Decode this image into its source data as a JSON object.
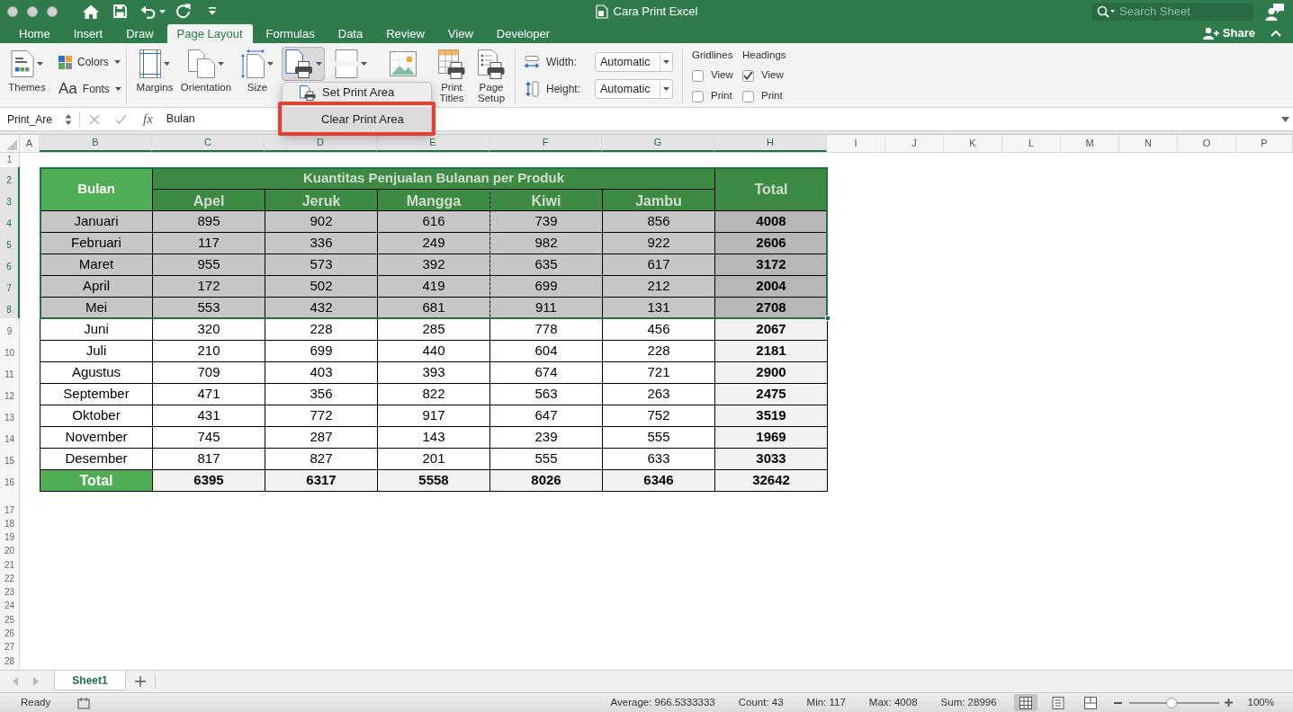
{
  "window": {
    "title": "Cara Print Excel"
  },
  "title_bar": {
    "search": {
      "placeholder": "Search Sheet"
    },
    "share": {
      "label": "Share"
    }
  },
  "tabs": [
    {
      "label": "Home",
      "selected": false
    },
    {
      "label": "Insert",
      "selected": false
    },
    {
      "label": "Draw",
      "selected": false
    },
    {
      "label": "Page Layout",
      "selected": true
    },
    {
      "label": "Formulas",
      "selected": false
    },
    {
      "label": "Data",
      "selected": false
    },
    {
      "label": "Review",
      "selected": false
    },
    {
      "label": "View",
      "selected": false
    },
    {
      "label": "Developer",
      "selected": false
    }
  ],
  "ribbon": {
    "themes": [
      {
        "kind": "themes",
        "label": "Themes",
        "dropdown": true,
        "pressed": false
      },
      {
        "kind": "colors",
        "label": "Colors",
        "dropdown": true,
        "pressed": false
      },
      {
        "kind": "fonts",
        "glyph": "Aa",
        "label": "Fonts",
        "dropdown": true,
        "pressed": false
      }
    ],
    "page_setup": [
      {
        "kind": "margins",
        "label": "Margins",
        "dropdown": true,
        "pressed": false
      },
      {
        "kind": "orientation",
        "label": "Orientation",
        "dropdown": true,
        "pressed": false
      },
      {
        "kind": "size",
        "label": "Size",
        "dropdown": true,
        "pressed": false
      },
      {
        "kind": "print_area",
        "dropdown": true,
        "pressed": true
      },
      {
        "kind": "breaks",
        "dropdown": true,
        "pressed": false
      },
      {
        "kind": "background",
        "dropdown": false,
        "pressed": false
      },
      {
        "kind": "print_titles",
        "label": "Print Titles",
        "dropdown": false,
        "pressed": false
      },
      {
        "kind": "page_setup",
        "label": "Page Setup",
        "dropdown": false,
        "pressed": false
      }
    ],
    "scale": [
      {
        "kind": "width",
        "label": "Width:",
        "value": "Automatic"
      },
      {
        "kind": "height",
        "label": "Height:",
        "value": "Automatic"
      }
    ],
    "sheet_options": [
      {
        "title": "Gridlines",
        "options": [
          {
            "label": "View",
            "checked": false
          },
          {
            "label": "Print",
            "checked": false
          }
        ]
      },
      {
        "title": "Headings",
        "options": [
          {
            "label": "View",
            "checked": true
          },
          {
            "label": "Print",
            "checked": false
          }
        ]
      }
    ]
  },
  "print_area_menu": [
    {
      "kind": "set",
      "label": "Set Print Area",
      "hovered": false,
      "outlined": false
    },
    {
      "kind": "clear",
      "label": "Clear Print Area",
      "hovered": true,
      "outlined": true
    }
  ],
  "formula_bar": {
    "name_box": "Print_Are",
    "function_label": "fx",
    "formula": "Bulan"
  },
  "columns": [
    {
      "label": "A",
      "selected": false
    },
    {
      "label": "B",
      "selected": true
    },
    {
      "label": "C",
      "selected": true
    },
    {
      "label": "D",
      "selected": true
    },
    {
      "label": "E",
      "selected": true
    },
    {
      "label": "F",
      "selected": true
    },
    {
      "label": "G",
      "selected": true
    },
    {
      "label": "H",
      "selected": true
    },
    {
      "label": "I",
      "selected": false
    },
    {
      "label": "J",
      "selected": false
    },
    {
      "label": "K",
      "selected": false
    },
    {
      "label": "L",
      "selected": false
    },
    {
      "label": "M",
      "selected": false
    },
    {
      "label": "N",
      "selected": false
    },
    {
      "label": "O",
      "selected": false
    },
    {
      "label": "P",
      "selected": false
    }
  ],
  "rows": [
    {
      "label": "1",
      "selected": false
    },
    {
      "label": "2",
      "selected": true
    },
    {
      "label": "3",
      "selected": true
    },
    {
      "label": "4",
      "selected": true
    },
    {
      "label": "5",
      "selected": true
    },
    {
      "label": "6",
      "selected": true
    },
    {
      "label": "7",
      "selected": true
    },
    {
      "label": "8",
      "selected": true
    },
    {
      "label": "9",
      "selected": false
    },
    {
      "label": "10",
      "selected": false
    },
    {
      "label": "11",
      "selected": false
    },
    {
      "label": "12",
      "selected": false
    },
    {
      "label": "13",
      "selected": false
    },
    {
      "label": "14",
      "selected": false
    },
    {
      "label": "15",
      "selected": false
    },
    {
      "label": "16",
      "selected": false
    },
    {
      "label": "17",
      "selected": false
    },
    {
      "label": "18",
      "selected": false
    },
    {
      "label": "19",
      "selected": false
    },
    {
      "label": "20",
      "selected": false
    },
    {
      "label": "21",
      "selected": false
    },
    {
      "label": "22",
      "selected": false
    },
    {
      "label": "23",
      "selected": false
    },
    {
      "label": "24",
      "selected": false
    },
    {
      "label": "25",
      "selected": false
    },
    {
      "label": "26",
      "selected": false
    },
    {
      "label": "27",
      "selected": false
    },
    {
      "label": "28",
      "selected": false
    }
  ],
  "table": {
    "header": {
      "selected": true,
      "month": {
        "label": "Bulan",
        "active": true
      },
      "group": "Kuantitas Penjualan Bulanan per Produk",
      "products": [
        "Apel",
        "Jeruk",
        "Mangga",
        "Kiwi",
        "Jambu"
      ],
      "total": "Total"
    },
    "rows": [
      {
        "month": "Januari",
        "values": [
          "895",
          "902",
          "616",
          "739",
          "856"
        ],
        "total": "4008",
        "selected": true
      },
      {
        "month": "Februari",
        "values": [
          "117",
          "336",
          "249",
          "982",
          "922"
        ],
        "total": "2606",
        "selected": true
      },
      {
        "month": "Maret",
        "values": [
          "955",
          "573",
          "392",
          "635",
          "617"
        ],
        "total": "3172",
        "selected": true
      },
      {
        "month": "April",
        "values": [
          "172",
          "502",
          "419",
          "699",
          "212"
        ],
        "total": "2004",
        "selected": true
      },
      {
        "month": "Mei",
        "values": [
          "553",
          "432",
          "681",
          "911",
          "131"
        ],
        "total": "2708",
        "selected": true
      },
      {
        "month": "Juni",
        "values": [
          "320",
          "228",
          "285",
          "778",
          "456"
        ],
        "total": "2067",
        "selected": false
      },
      {
        "month": "Juli",
        "values": [
          "210",
          "699",
          "440",
          "604",
          "228"
        ],
        "total": "2181",
        "selected": false
      },
      {
        "month": "Agustus",
        "values": [
          "709",
          "403",
          "393",
          "674",
          "721"
        ],
        "total": "2900",
        "selected": false
      },
      {
        "month": "September",
        "values": [
          "471",
          "356",
          "822",
          "563",
          "263"
        ],
        "total": "2475",
        "selected": false
      },
      {
        "month": "Oktober",
        "values": [
          "431",
          "772",
          "917",
          "647",
          "752"
        ],
        "total": "3519",
        "selected": false
      },
      {
        "month": "November",
        "values": [
          "745",
          "287",
          "143",
          "239",
          "555"
        ],
        "total": "1969",
        "selected": false
      },
      {
        "month": "Desember",
        "values": [
          "817",
          "827",
          "201",
          "555",
          "633"
        ],
        "total": "3033",
        "selected": false
      }
    ],
    "footer": {
      "label": "Total",
      "values": [
        "6395",
        "6317",
        "5558",
        "8026",
        "6346"
      ],
      "total": "32642"
    }
  },
  "sheet_tabs": [
    {
      "label": "Sheet1",
      "selected": true
    }
  ],
  "status_bar": {
    "mode": "Ready",
    "stats": [
      "Average: 966.5333333",
      "Count: 43",
      "Min: 117",
      "Max: 4008",
      "Sum: 28996"
    ],
    "views": [
      {
        "kind": "normal",
        "selected": true
      },
      {
        "kind": "page_layout",
        "selected": false
      },
      {
        "kind": "page_break",
        "selected": false
      }
    ],
    "zoom": {
      "level": 0.47,
      "label": "100%"
    }
  }
}
